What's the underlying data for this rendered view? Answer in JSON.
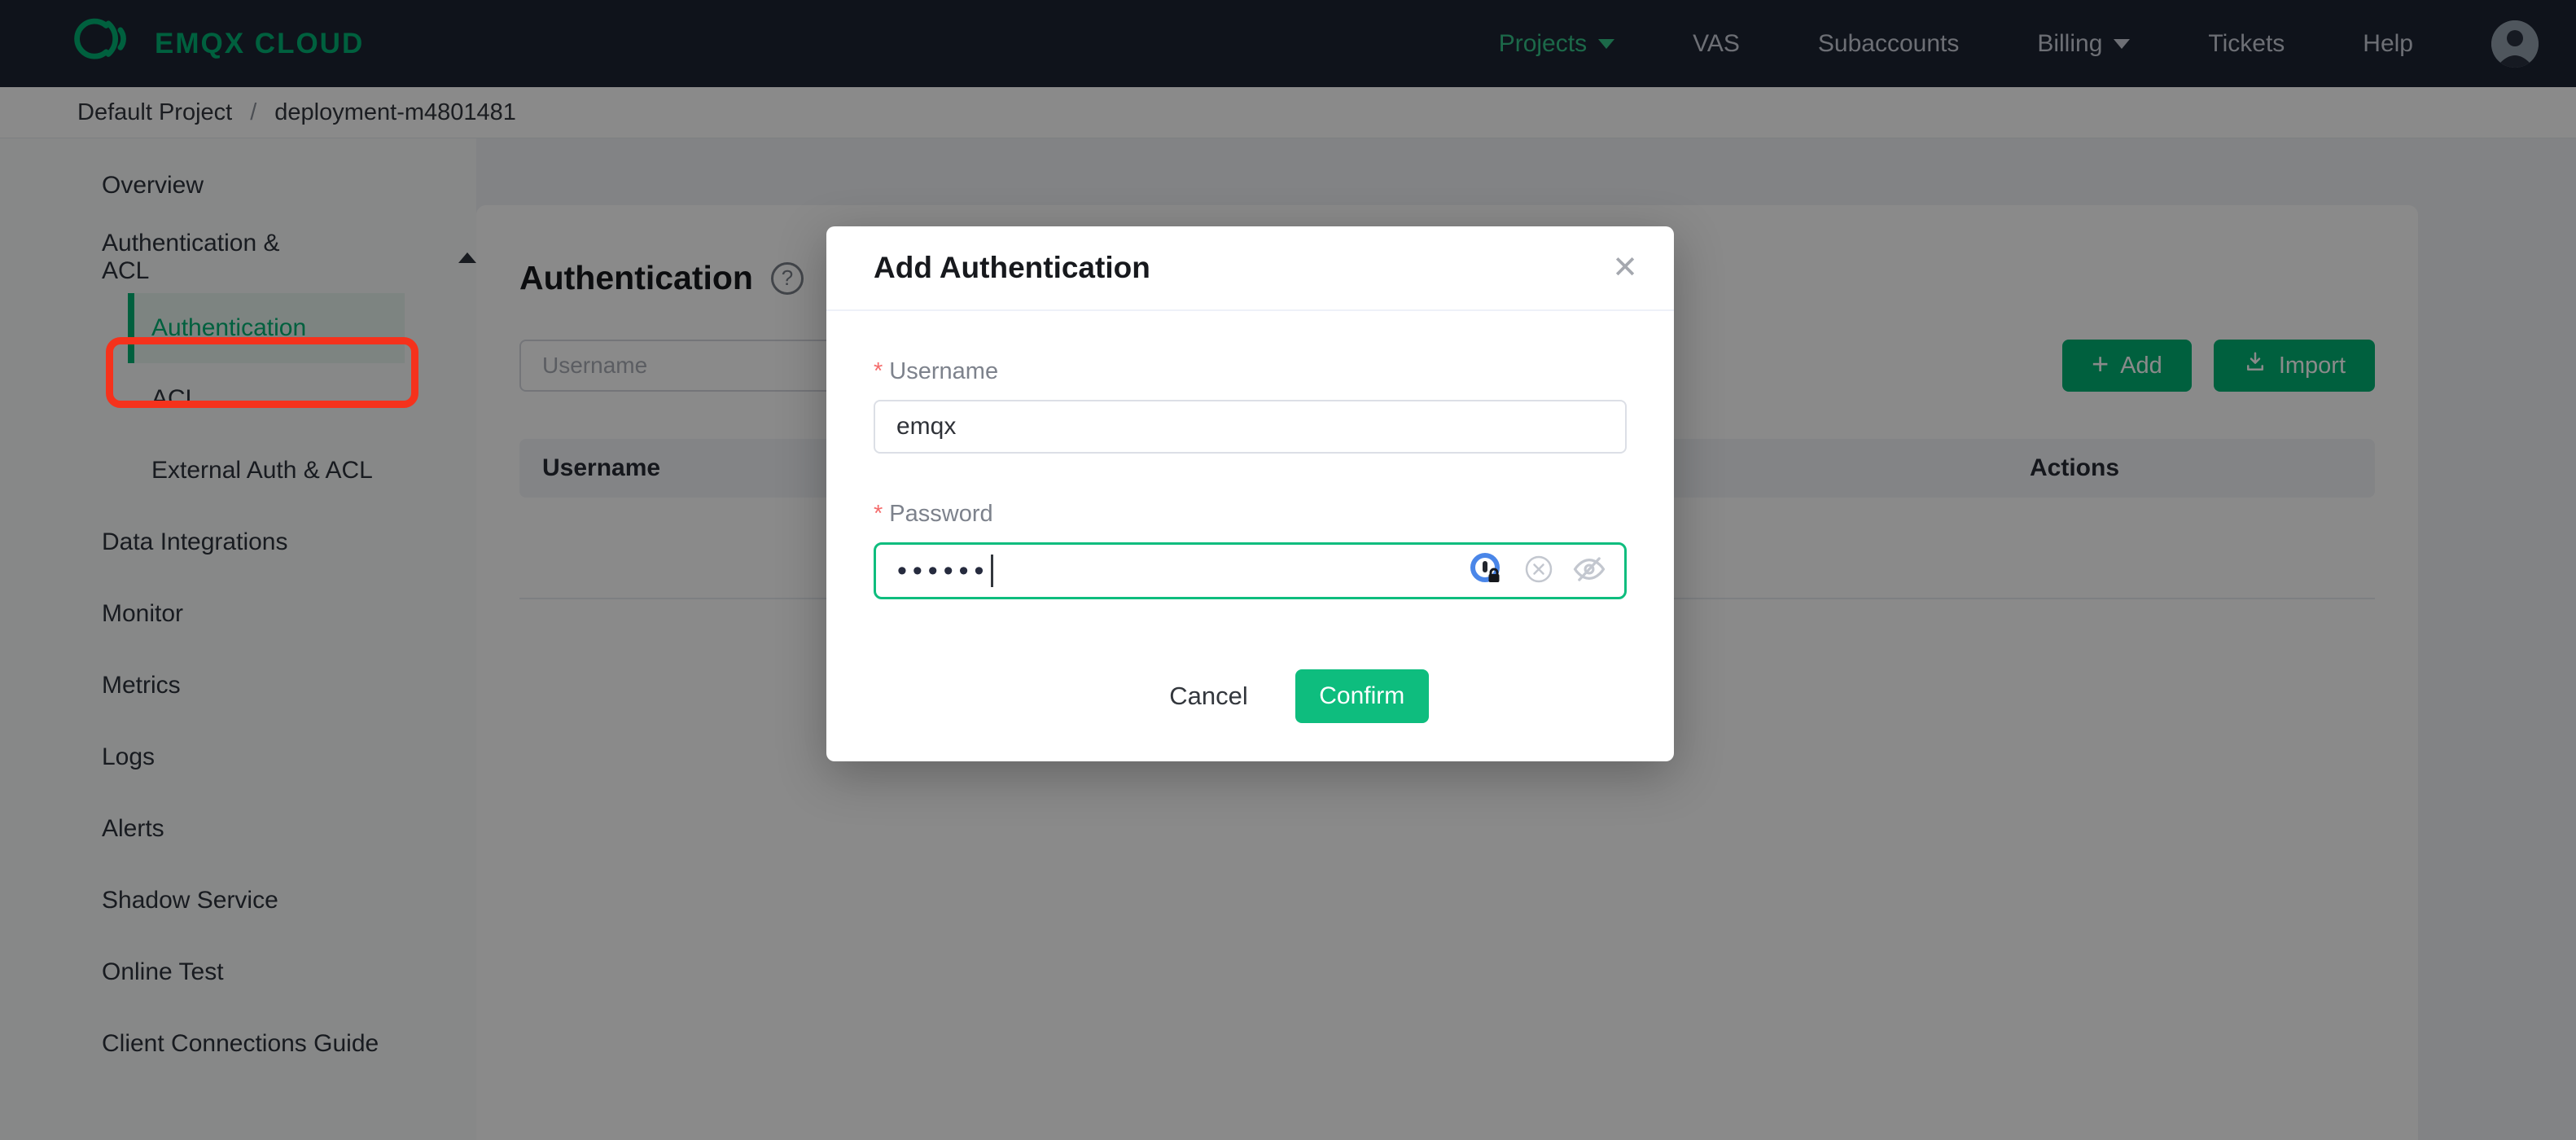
{
  "navbar": {
    "brand": "EMQX CLOUD",
    "items": [
      {
        "label": "Projects",
        "active": true,
        "has_caret": true
      },
      {
        "label": "VAS"
      },
      {
        "label": "Subaccounts"
      },
      {
        "label": "Billing",
        "has_caret": true
      },
      {
        "label": "Tickets"
      },
      {
        "label": "Help"
      }
    ]
  },
  "breadcrumb": {
    "project": "Default Project",
    "separator": "/",
    "deployment": "deployment-m4801481"
  },
  "sidebar": {
    "items": [
      {
        "label": "Overview",
        "level": 1
      },
      {
        "label": "Authentication & ACL",
        "level": 1,
        "expanded": true
      },
      {
        "label": "Authentication",
        "level": 2,
        "active": true,
        "annotated": true
      },
      {
        "label": "ACL",
        "level": 2
      },
      {
        "label": "External Auth & ACL",
        "level": 2
      },
      {
        "label": "Data Integrations",
        "level": 1
      },
      {
        "label": "Monitor",
        "level": 1
      },
      {
        "label": "Metrics",
        "level": 1
      },
      {
        "label": "Logs",
        "level": 1
      },
      {
        "label": "Alerts",
        "level": 1
      },
      {
        "label": "Shadow Service",
        "level": 1
      },
      {
        "label": "Online Test",
        "level": 1
      },
      {
        "label": "Client Connections Guide",
        "level": 1
      }
    ]
  },
  "main": {
    "title": "Authentication",
    "help_icon": "?",
    "search_placeholder": "Username",
    "add_label": "Add",
    "import_label": "Import",
    "table": {
      "columns": [
        "Username",
        "Actions"
      ]
    }
  },
  "modal": {
    "title": "Add Authentication",
    "close_glyph": "✕",
    "fields": [
      {
        "label": "Username",
        "required": true,
        "value": "emqx"
      },
      {
        "label": "Password",
        "required": true,
        "masked_value": "••••••"
      }
    ],
    "password_icons": [
      "password-manager-icon",
      "clear-icon",
      "toggle-visibility-icon"
    ],
    "cancel_label": "Cancel",
    "confirm_label": "Confirm"
  },
  "colors": {
    "accent_green": "#00b173",
    "confirm_green": "#0ebd7e",
    "annotation_red": "#f5321c",
    "required_red": "#f56c6c",
    "navbar_bg": "#1c2433"
  }
}
